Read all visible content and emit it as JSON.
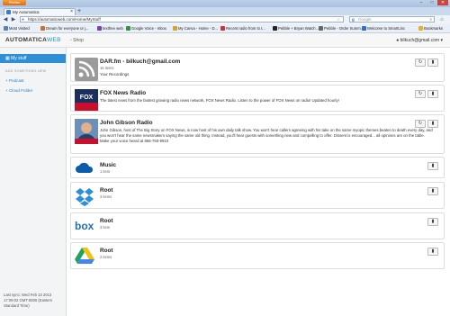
{
  "browser": {
    "menu_label": "Firefox",
    "tab_title": "My Automatica",
    "url": "https://automaticweb.com/Home/MyStuff",
    "search_placeholder": "Google",
    "search_engine_glyph": "g",
    "new_tab_glyph": "+",
    "bookmarks": [
      {
        "label": "Most Visited",
        "color": "#5b7fb5"
      },
      {
        "label": "Dream for everyone or j...",
        "color": "#d36a2f"
      },
      {
        "label": "textfree web",
        "color": "#7a3fb0"
      },
      {
        "label": "Google Voice - Inbox",
        "color": "#3b8f3b"
      },
      {
        "label": "My Canva - Home - D...",
        "color": "#d3a22f"
      },
      {
        "label": "Recent radio from to t...",
        "color": "#c33"
      },
      {
        "label": "Pebble + Bryan Watch...",
        "color": "#222"
      },
      {
        "label": "Pebble - Order Summ...",
        "color": "#666"
      },
      {
        "label": "Welcome to SmartLinc",
        "color": "#2a6fc9"
      }
    ],
    "bookmarks_menu_label": "Bookmarks"
  },
  "app": {
    "logo_main": "AUTOMATICA",
    "logo_accent": "WEB",
    "shop_label": "Shop",
    "user_email": "bilkuch@gmail.com"
  },
  "sidebar": {
    "active_item": "My stuff",
    "section_header": "ADD SOMETHING NEW",
    "links": [
      "Podcast",
      "Cloud Folder"
    ],
    "last_sync": "Last sync: Wed Feb 13 2013 17:09:02 GMT-0600 (Eastern Standard Time)"
  },
  "cards": [
    {
      "title": "DAR.fm - bilkuch@gmail.com",
      "sub": "16 items",
      "desc": "Your Recordings",
      "thumb": "rss"
    },
    {
      "title": "FOX News Radio",
      "sub": "",
      "desc": "The latest news from the fastest growing radio news network, FOX News Radio. Listen to the power of FOX News on radio! Updated hourly!",
      "thumb": "fox"
    },
    {
      "title": "John Gibson Radio",
      "sub": "",
      "desc": "John Gibson, host of The Big Story on FOX News, is now host of his own daily talk show. You won't hear callers agreeing with his take on the same myopic themes beaten to death every day, and you won't hear the same newsmakers saying the same old thing. Instead, you'll hear guests with something new and compelling to offer. Dissent is encouraged... all opinions are on the table. Make your voice heard at 866-760-9910",
      "thumb": "photo"
    },
    {
      "title": "Music",
      "sub": "1 item",
      "desc": "",
      "thumb": "onedrive"
    },
    {
      "title": "Root",
      "sub": "3 items",
      "desc": "",
      "thumb": "dropbox"
    },
    {
      "title": "Root",
      "sub": "3 item",
      "desc": "",
      "thumb": "box"
    },
    {
      "title": "Root",
      "sub": "2 items",
      "desc": "",
      "thumb": "drive"
    }
  ],
  "colors": {
    "accent": "#2e8fd6",
    "rss": "#9a9a9a"
  }
}
